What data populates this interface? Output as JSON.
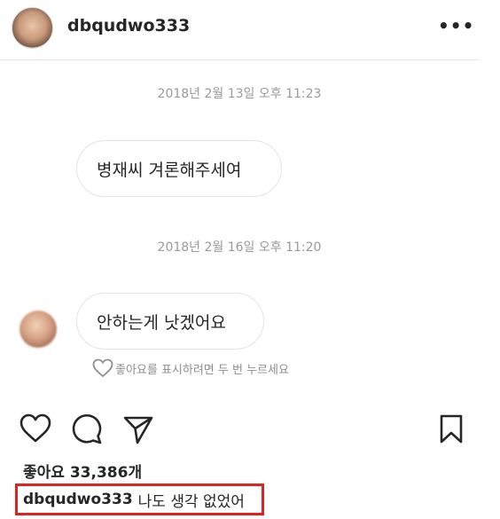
{
  "header": {
    "username": "dbqudwo333",
    "more_label": "•••"
  },
  "messages": [
    {
      "timestamp": "2018년 2월 13일 오후 11:23",
      "text": "병재씨 겨론해주세여"
    },
    {
      "timestamp": "2018년 2월 16일 오후 11:20",
      "text": "안하는게 낫겠어요"
    }
  ],
  "like_hint": "좋아요를 표시하려면 두 번 누르세요",
  "actions": {
    "icons": [
      "heart-icon",
      "comment-icon",
      "share-icon",
      "bookmark-icon"
    ]
  },
  "likes": "좋아요 33,386개",
  "caption": {
    "username": "dbqudwo333",
    "text": "나도 생각 없었어"
  },
  "colors": {
    "highlight_border": "#e0231e",
    "muted_text": "#9a9a9a"
  }
}
